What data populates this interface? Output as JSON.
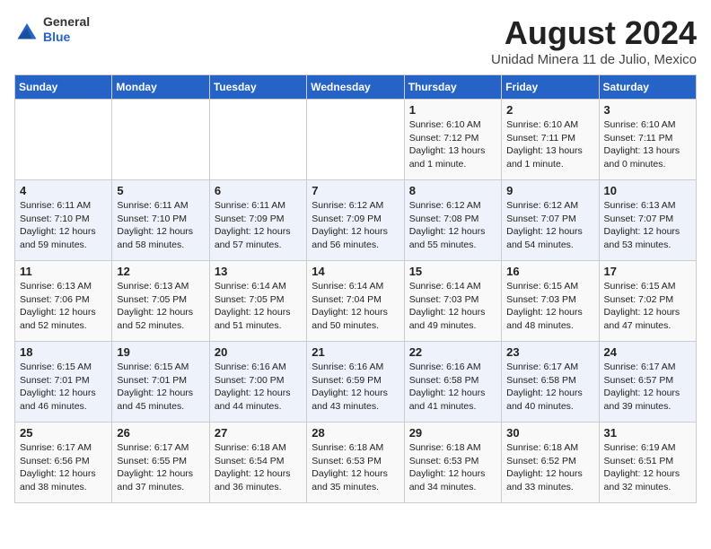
{
  "header": {
    "logo_line1": "General",
    "logo_line2": "Blue",
    "title": "August 2024",
    "subtitle": "Unidad Minera 11 de Julio, Mexico"
  },
  "days_of_week": [
    "Sunday",
    "Monday",
    "Tuesday",
    "Wednesday",
    "Thursday",
    "Friday",
    "Saturday"
  ],
  "weeks": [
    [
      null,
      null,
      null,
      null,
      {
        "day": 1,
        "sunrise": "6:10 AM",
        "sunset": "7:12 PM",
        "daylight": "13 hours and 1 minute."
      },
      {
        "day": 2,
        "sunrise": "6:10 AM",
        "sunset": "7:11 PM",
        "daylight": "13 hours and 1 minute."
      },
      {
        "day": 3,
        "sunrise": "6:10 AM",
        "sunset": "7:11 PM",
        "daylight": "13 hours and 0 minutes."
      }
    ],
    [
      {
        "day": 4,
        "sunrise": "6:11 AM",
        "sunset": "7:10 PM",
        "daylight": "12 hours and 59 minutes."
      },
      {
        "day": 5,
        "sunrise": "6:11 AM",
        "sunset": "7:10 PM",
        "daylight": "12 hours and 58 minutes."
      },
      {
        "day": 6,
        "sunrise": "6:11 AM",
        "sunset": "7:09 PM",
        "daylight": "12 hours and 57 minutes."
      },
      {
        "day": 7,
        "sunrise": "6:12 AM",
        "sunset": "7:09 PM",
        "daylight": "12 hours and 56 minutes."
      },
      {
        "day": 8,
        "sunrise": "6:12 AM",
        "sunset": "7:08 PM",
        "daylight": "12 hours and 55 minutes."
      },
      {
        "day": 9,
        "sunrise": "6:12 AM",
        "sunset": "7:07 PM",
        "daylight": "12 hours and 54 minutes."
      },
      {
        "day": 10,
        "sunrise": "6:13 AM",
        "sunset": "7:07 PM",
        "daylight": "12 hours and 53 minutes."
      }
    ],
    [
      {
        "day": 11,
        "sunrise": "6:13 AM",
        "sunset": "7:06 PM",
        "daylight": "12 hours and 52 minutes."
      },
      {
        "day": 12,
        "sunrise": "6:13 AM",
        "sunset": "7:05 PM",
        "daylight": "12 hours and 52 minutes."
      },
      {
        "day": 13,
        "sunrise": "6:14 AM",
        "sunset": "7:05 PM",
        "daylight": "12 hours and 51 minutes."
      },
      {
        "day": 14,
        "sunrise": "6:14 AM",
        "sunset": "7:04 PM",
        "daylight": "12 hours and 50 minutes."
      },
      {
        "day": 15,
        "sunrise": "6:14 AM",
        "sunset": "7:03 PM",
        "daylight": "12 hours and 49 minutes."
      },
      {
        "day": 16,
        "sunrise": "6:15 AM",
        "sunset": "7:03 PM",
        "daylight": "12 hours and 48 minutes."
      },
      {
        "day": 17,
        "sunrise": "6:15 AM",
        "sunset": "7:02 PM",
        "daylight": "12 hours and 47 minutes."
      }
    ],
    [
      {
        "day": 18,
        "sunrise": "6:15 AM",
        "sunset": "7:01 PM",
        "daylight": "12 hours and 46 minutes."
      },
      {
        "day": 19,
        "sunrise": "6:15 AM",
        "sunset": "7:01 PM",
        "daylight": "12 hours and 45 minutes."
      },
      {
        "day": 20,
        "sunrise": "6:16 AM",
        "sunset": "7:00 PM",
        "daylight": "12 hours and 44 minutes."
      },
      {
        "day": 21,
        "sunrise": "6:16 AM",
        "sunset": "6:59 PM",
        "daylight": "12 hours and 43 minutes."
      },
      {
        "day": 22,
        "sunrise": "6:16 AM",
        "sunset": "6:58 PM",
        "daylight": "12 hours and 41 minutes."
      },
      {
        "day": 23,
        "sunrise": "6:17 AM",
        "sunset": "6:58 PM",
        "daylight": "12 hours and 40 minutes."
      },
      {
        "day": 24,
        "sunrise": "6:17 AM",
        "sunset": "6:57 PM",
        "daylight": "12 hours and 39 minutes."
      }
    ],
    [
      {
        "day": 25,
        "sunrise": "6:17 AM",
        "sunset": "6:56 PM",
        "daylight": "12 hours and 38 minutes."
      },
      {
        "day": 26,
        "sunrise": "6:17 AM",
        "sunset": "6:55 PM",
        "daylight": "12 hours and 37 minutes."
      },
      {
        "day": 27,
        "sunrise": "6:18 AM",
        "sunset": "6:54 PM",
        "daylight": "12 hours and 36 minutes."
      },
      {
        "day": 28,
        "sunrise": "6:18 AM",
        "sunset": "6:53 PM",
        "daylight": "12 hours and 35 minutes."
      },
      {
        "day": 29,
        "sunrise": "6:18 AM",
        "sunset": "6:53 PM",
        "daylight": "12 hours and 34 minutes."
      },
      {
        "day": 30,
        "sunrise": "6:18 AM",
        "sunset": "6:52 PM",
        "daylight": "12 hours and 33 minutes."
      },
      {
        "day": 31,
        "sunrise": "6:19 AM",
        "sunset": "6:51 PM",
        "daylight": "12 hours and 32 minutes."
      }
    ]
  ]
}
